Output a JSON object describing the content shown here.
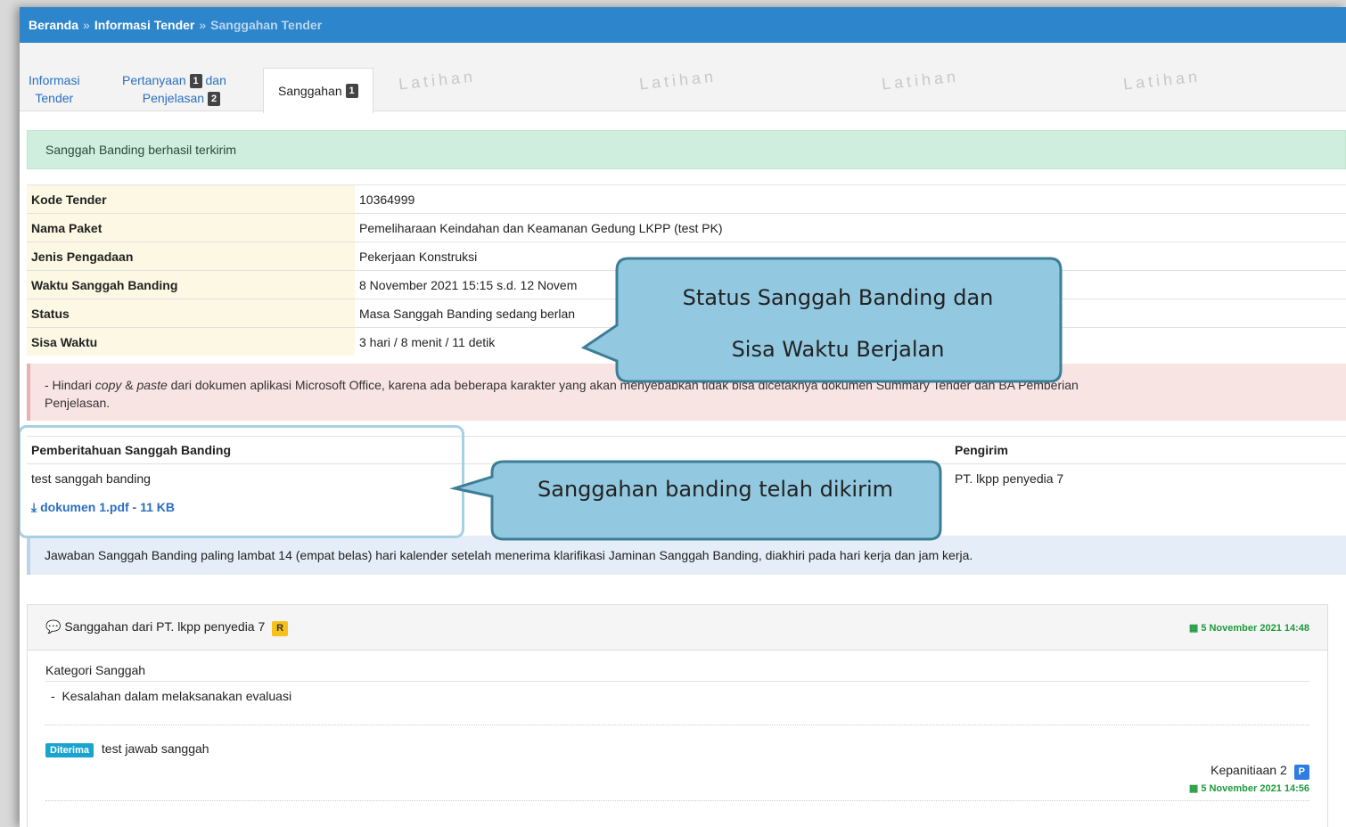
{
  "breadcrumb": {
    "home": "Beranda",
    "separator": "»",
    "section": "Informasi Tender",
    "current": "Sanggahan Tender"
  },
  "tabs": {
    "informasi_line1": "Informasi",
    "informasi_line2": "Tender",
    "pertanyaan_line1": "Pertanyaan",
    "pertanyaan_badge": "1",
    "pertanyaan_dan": "dan",
    "pertanyaan_line2": "Penjelasan",
    "penjelasan_badge": "2",
    "sanggahan_label": "Sanggahan",
    "sanggahan_badge": "1"
  },
  "watermark": "Latihan",
  "success_alert": "Sanggah Banding berhasil terkirim",
  "info": {
    "kode_label": "Kode Tender",
    "kode_value": "10364999",
    "nama_label": "Nama Paket",
    "nama_value": "Pemeliharaan Keindahan dan Keamanan Gedung LKPP (test PK)",
    "jenis_label": "Jenis Pengadaan",
    "jenis_value": "Pekerjaan Konstruksi",
    "waktu_label": "Waktu Sanggah Banding",
    "waktu_value": "8 November 2021 15:15 s.d. 12 Novem",
    "status_label": "Status",
    "status_value": "Masa Sanggah Banding sedang berlan",
    "sisa_label": "Sisa Waktu",
    "sisa_value": "3 hari / 8 menit / 11 detik"
  },
  "danger_alert": {
    "prefix": "- Hindari ",
    "copy": "copy",
    "amp": " & ",
    "paste": "paste",
    "rest_line1": " dari dokumen aplikasi Microsoft Office, karena ada beberapa karakter yang akan menyebabkan tidak bisa dicetaknya dokumen Summary Tender dan BA Pemberian",
    "line2": "Penjelasan."
  },
  "notice": {
    "col_pemberitahuan": "Pemberitahuan Sanggah Banding",
    "col_pengirim": "Pengirim",
    "text": "test sanggah banding",
    "file": "dokumen 1.pdf - 11 KB",
    "pengirim": "PT. lkpp penyedia 7"
  },
  "info_alert": "Jawaban Sanggah Banding paling lambat 14 (empat belas) hari kalender setelah menerima klarifikasi Jaminan Sanggah Banding, diakhiri pada hari kerja dan jam kerja.",
  "panel": {
    "title": "Sanggahan dari PT. lkpp penyedia 7",
    "title_badge": "R",
    "date": "5 November 2021 14:48",
    "kategori_title": "Kategori Sanggah",
    "kategori_item": "Kesalahan dalam melaksanakan evaluasi",
    "status_badge": "Diterima",
    "jawaban": "test jawab sanggah",
    "responder": "Kepanitiaan 2",
    "responder_badge": "P",
    "response_date": "5 November 2021 14:56"
  },
  "callouts": {
    "status_line1": "Status Sanggah Banding dan",
    "status_line2": "Sisa Waktu Berjalan",
    "sent": "Sanggahan banding telah dikirim"
  },
  "colors": {
    "header_blue": "#2d85cc",
    "callout_fill": "#92c9e0",
    "callout_border": "#3d7d97",
    "success_green": "#1d9a3c"
  }
}
